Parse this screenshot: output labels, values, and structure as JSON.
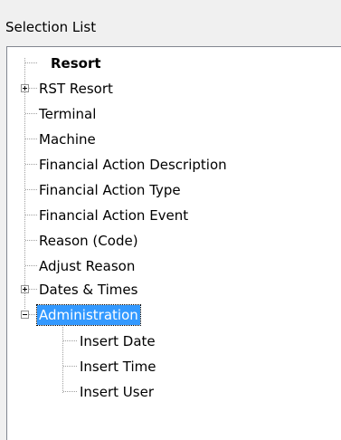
{
  "panel": {
    "title": "Selection List"
  },
  "tree": {
    "items": [
      {
        "label": "Resort",
        "bold": true
      },
      {
        "label": "RST  Resort",
        "expander": "collapsed"
      },
      {
        "label": "Terminal"
      },
      {
        "label": "Machine"
      },
      {
        "label": "Financial Action Description"
      },
      {
        "label": "Financial Action Type"
      },
      {
        "label": "Financial Action Event"
      },
      {
        "label": "Reason (Code)"
      },
      {
        "label": "Adjust Reason"
      },
      {
        "label": "Dates & Times",
        "expander": "collapsed"
      },
      {
        "label": "Administration",
        "expander": "expanded",
        "selected": true,
        "children": [
          {
            "label": "Insert Date"
          },
          {
            "label": "Insert Time"
          },
          {
            "label": "Insert User"
          }
        ]
      }
    ]
  },
  "colors": {
    "selection_bg": "#3399ff",
    "selection_fg": "#ffffff",
    "tree_line": "#a0a0a0"
  }
}
